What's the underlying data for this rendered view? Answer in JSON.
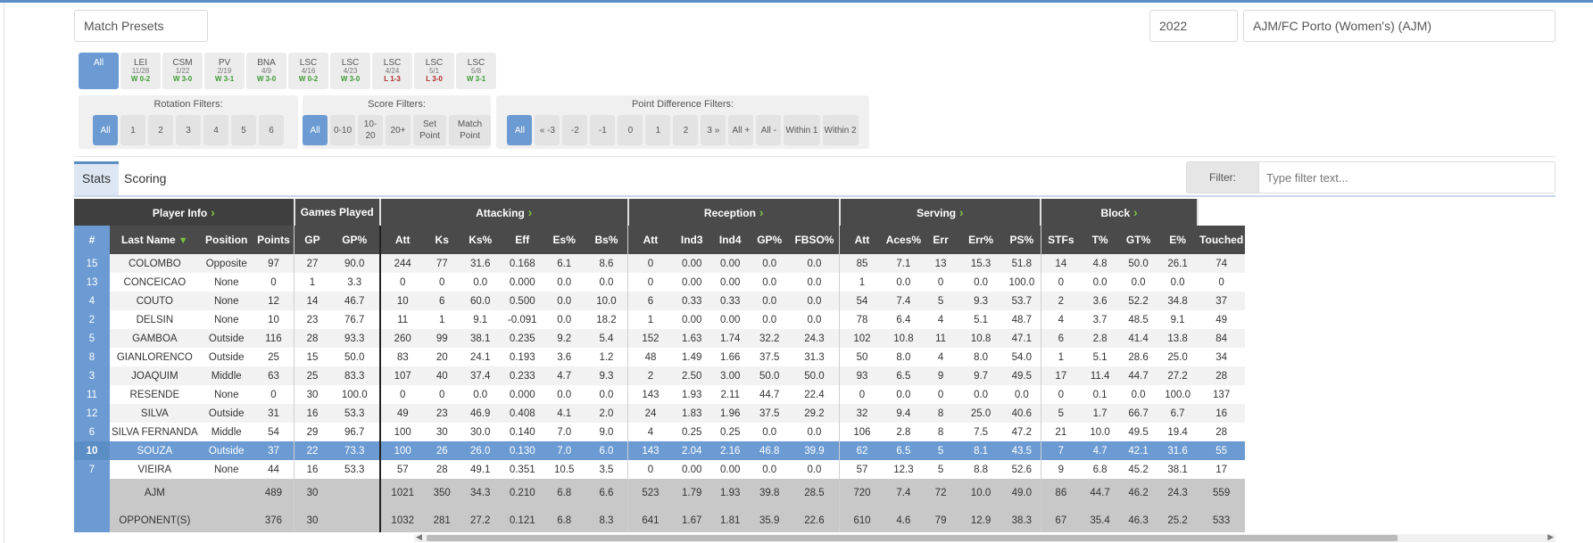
{
  "header": {
    "presets_label": "Match Presets",
    "season": "2022",
    "team": "AJM/FC Porto (Women's) (AJM)"
  },
  "matches": {
    "all_label": "All",
    "items": [
      {
        "opp": "LEI",
        "date": "11/28",
        "result": "W 0-2",
        "win": true
      },
      {
        "opp": "CSM",
        "date": "1/22",
        "result": "W 3-0",
        "win": true
      },
      {
        "opp": "PV",
        "date": "2/19",
        "result": "W 3-1",
        "win": true
      },
      {
        "opp": "BNA",
        "date": "4/9",
        "result": "W 3-0",
        "win": true
      },
      {
        "opp": "LSC",
        "date": "4/16",
        "result": "W 0-2",
        "win": true
      },
      {
        "opp": "LSC",
        "date": "4/23",
        "result": "W 3-0",
        "win": true
      },
      {
        "opp": "LSC",
        "date": "4/24",
        "result": "L 1-3",
        "win": false
      },
      {
        "opp": "LSC",
        "date": "5/1",
        "result": "L 3-0",
        "win": false
      },
      {
        "opp": "LSC",
        "date": "5/8",
        "result": "W 3-1",
        "win": true
      }
    ]
  },
  "filters": {
    "rotation": {
      "title": "Rotation Filters:",
      "buttons": [
        "All",
        "1",
        "2",
        "3",
        "4",
        "5",
        "6"
      ]
    },
    "score": {
      "title": "Score Filters:",
      "buttons": [
        "All",
        "0-10",
        "10-20",
        "20+",
        "Set Point",
        "Match Point"
      ]
    },
    "diff": {
      "title": "Point Difference Filters:",
      "buttons": [
        "All",
        "« -3",
        "-2",
        "-1",
        "0",
        "1",
        "2",
        "3 »",
        "All +",
        "All -",
        "Within 1",
        "Within 2"
      ]
    }
  },
  "tabs": {
    "stats": "Stats",
    "scoring": "Scoring"
  },
  "filter_box": {
    "label": "Filter:",
    "placeholder": "Type filter text..."
  },
  "table": {
    "groups": [
      "Player Info",
      "Games Played",
      "Attacking",
      "Reception",
      "Serving",
      "Block"
    ],
    "columns": [
      "#",
      "Last Name",
      "Position",
      "Points",
      "GP",
      "GP%",
      "Att",
      "Ks",
      "Ks%",
      "Eff",
      "Es%",
      "Bs%",
      "Att",
      "Ind3",
      "Ind4",
      "GP%",
      "FBSO%",
      "Att",
      "Aces%",
      "Err",
      "Err%",
      "PS%",
      "STFs",
      "T%",
      "GT%",
      "E%",
      "Touched"
    ],
    "rows": [
      [
        "15",
        "COLOMBO",
        "Opposite",
        "97",
        "27",
        "90.0",
        "244",
        "77",
        "31.6",
        "0.168",
        "6.1",
        "8.6",
        "0",
        "0.00",
        "0.00",
        "0.0",
        "0.0",
        "85",
        "7.1",
        "13",
        "15.3",
        "51.8",
        "14",
        "4.8",
        "50.0",
        "26.1",
        "74"
      ],
      [
        "13",
        "CONCEICAO",
        "None",
        "0",
        "1",
        "3.3",
        "0",
        "0",
        "0.0",
        "0.000",
        "0.0",
        "0.0",
        "0",
        "0.00",
        "0.00",
        "0.0",
        "0.0",
        "1",
        "0.0",
        "0",
        "0.0",
        "100.0",
        "0",
        "0.0",
        "0.0",
        "0.0",
        "0"
      ],
      [
        "4",
        "COUTO",
        "None",
        "12",
        "14",
        "46.7",
        "10",
        "6",
        "60.0",
        "0.500",
        "0.0",
        "10.0",
        "6",
        "0.33",
        "0.33",
        "0.0",
        "0.0",
        "54",
        "7.4",
        "5",
        "9.3",
        "53.7",
        "2",
        "3.6",
        "52.2",
        "34.8",
        "37"
      ],
      [
        "2",
        "DELSIN",
        "None",
        "10",
        "23",
        "76.7",
        "11",
        "1",
        "9.1",
        "-0.091",
        "0.0",
        "18.2",
        "1",
        "0.00",
        "0.00",
        "0.0",
        "0.0",
        "78",
        "6.4",
        "4",
        "5.1",
        "48.7",
        "4",
        "3.7",
        "48.5",
        "9.1",
        "49"
      ],
      [
        "5",
        "GAMBOA",
        "Outside",
        "116",
        "28",
        "93.3",
        "260",
        "99",
        "38.1",
        "0.235",
        "9.2",
        "5.4",
        "152",
        "1.63",
        "1.74",
        "32.2",
        "24.3",
        "102",
        "10.8",
        "11",
        "10.8",
        "47.1",
        "6",
        "2.8",
        "41.4",
        "13.8",
        "84"
      ],
      [
        "8",
        "GIANLORENCO",
        "Outside",
        "25",
        "15",
        "50.0",
        "83",
        "20",
        "24.1",
        "0.193",
        "3.6",
        "1.2",
        "48",
        "1.49",
        "1.66",
        "37.5",
        "31.3",
        "50",
        "8.0",
        "4",
        "8.0",
        "54.0",
        "1",
        "5.1",
        "28.6",
        "25.0",
        "34"
      ],
      [
        "3",
        "JOAQUIM",
        "Middle",
        "63",
        "25",
        "83.3",
        "107",
        "40",
        "37.4",
        "0.233",
        "4.7",
        "9.3",
        "2",
        "2.50",
        "3.00",
        "50.0",
        "50.0",
        "93",
        "6.5",
        "9",
        "9.7",
        "49.5",
        "17",
        "11.4",
        "44.7",
        "27.2",
        "28"
      ],
      [
        "11",
        "RESENDE",
        "None",
        "0",
        "30",
        "100.0",
        "0",
        "0",
        "0.0",
        "0.000",
        "0.0",
        "0.0",
        "143",
        "1.93",
        "2.11",
        "44.7",
        "22.4",
        "0",
        "0.0",
        "0",
        "0.0",
        "0.0",
        "0",
        "0.1",
        "0.0",
        "100.0",
        "137"
      ],
      [
        "12",
        "SILVA",
        "Outside",
        "31",
        "16",
        "53.3",
        "49",
        "23",
        "46.9",
        "0.408",
        "4.1",
        "2.0",
        "24",
        "1.83",
        "1.96",
        "37.5",
        "29.2",
        "32",
        "9.4",
        "8",
        "25.0",
        "40.6",
        "5",
        "1.7",
        "66.7",
        "6.7",
        "16"
      ],
      [
        "6",
        "SILVA FERNANDA",
        "Middle",
        "54",
        "29",
        "96.7",
        "100",
        "30",
        "30.0",
        "0.140",
        "7.0",
        "9.0",
        "4",
        "0.25",
        "0.25",
        "0.0",
        "0.0",
        "106",
        "2.8",
        "8",
        "7.5",
        "47.2",
        "21",
        "10.0",
        "49.5",
        "19.4",
        "28"
      ],
      [
        "10",
        "SOUZA",
        "Outside",
        "37",
        "22",
        "73.3",
        "100",
        "26",
        "26.0",
        "0.130",
        "7.0",
        "6.0",
        "143",
        "2.04",
        "2.16",
        "46.8",
        "39.9",
        "62",
        "6.5",
        "5",
        "8.1",
        "43.5",
        "7",
        "4.7",
        "42.1",
        "31.6",
        "55"
      ],
      [
        "7",
        "VIEIRA",
        "None",
        "44",
        "16",
        "53.3",
        "57",
        "28",
        "49.1",
        "0.351",
        "10.5",
        "3.5",
        "0",
        "0.00",
        "0.00",
        "0.0",
        "0.0",
        "57",
        "12.3",
        "5",
        "8.8",
        "52.6",
        "9",
        "6.8",
        "45.2",
        "38.1",
        "17"
      ]
    ],
    "selected_row_index": 10,
    "totals": [
      [
        "",
        "AJM",
        "",
        "489",
        "30",
        "",
        "1021",
        "350",
        "34.3",
        "0.210",
        "6.8",
        "6.6",
        "523",
        "1.79",
        "1.93",
        "39.8",
        "28.5",
        "720",
        "7.4",
        "72",
        "10.0",
        "49.0",
        "86",
        "44.7",
        "46.2",
        "24.3",
        "559"
      ],
      [
        "",
        "OPPONENT(S)",
        "",
        "376",
        "30",
        "",
        "1032",
        "281",
        "27.2",
        "0.121",
        "6.8",
        "8.3",
        "641",
        "1.67",
        "1.81",
        "35.9",
        "22.6",
        "610",
        "4.6",
        "79",
        "12.9",
        "38.3",
        "67",
        "35.4",
        "46.3",
        "25.2",
        "533"
      ]
    ]
  },
  "colors": {
    "accent": "#6b9bd2",
    "header_dark": "#4a4a4a",
    "win": "#3f9c35",
    "loss": "#b22a2a",
    "expand_arrow": "#7ec23e"
  }
}
